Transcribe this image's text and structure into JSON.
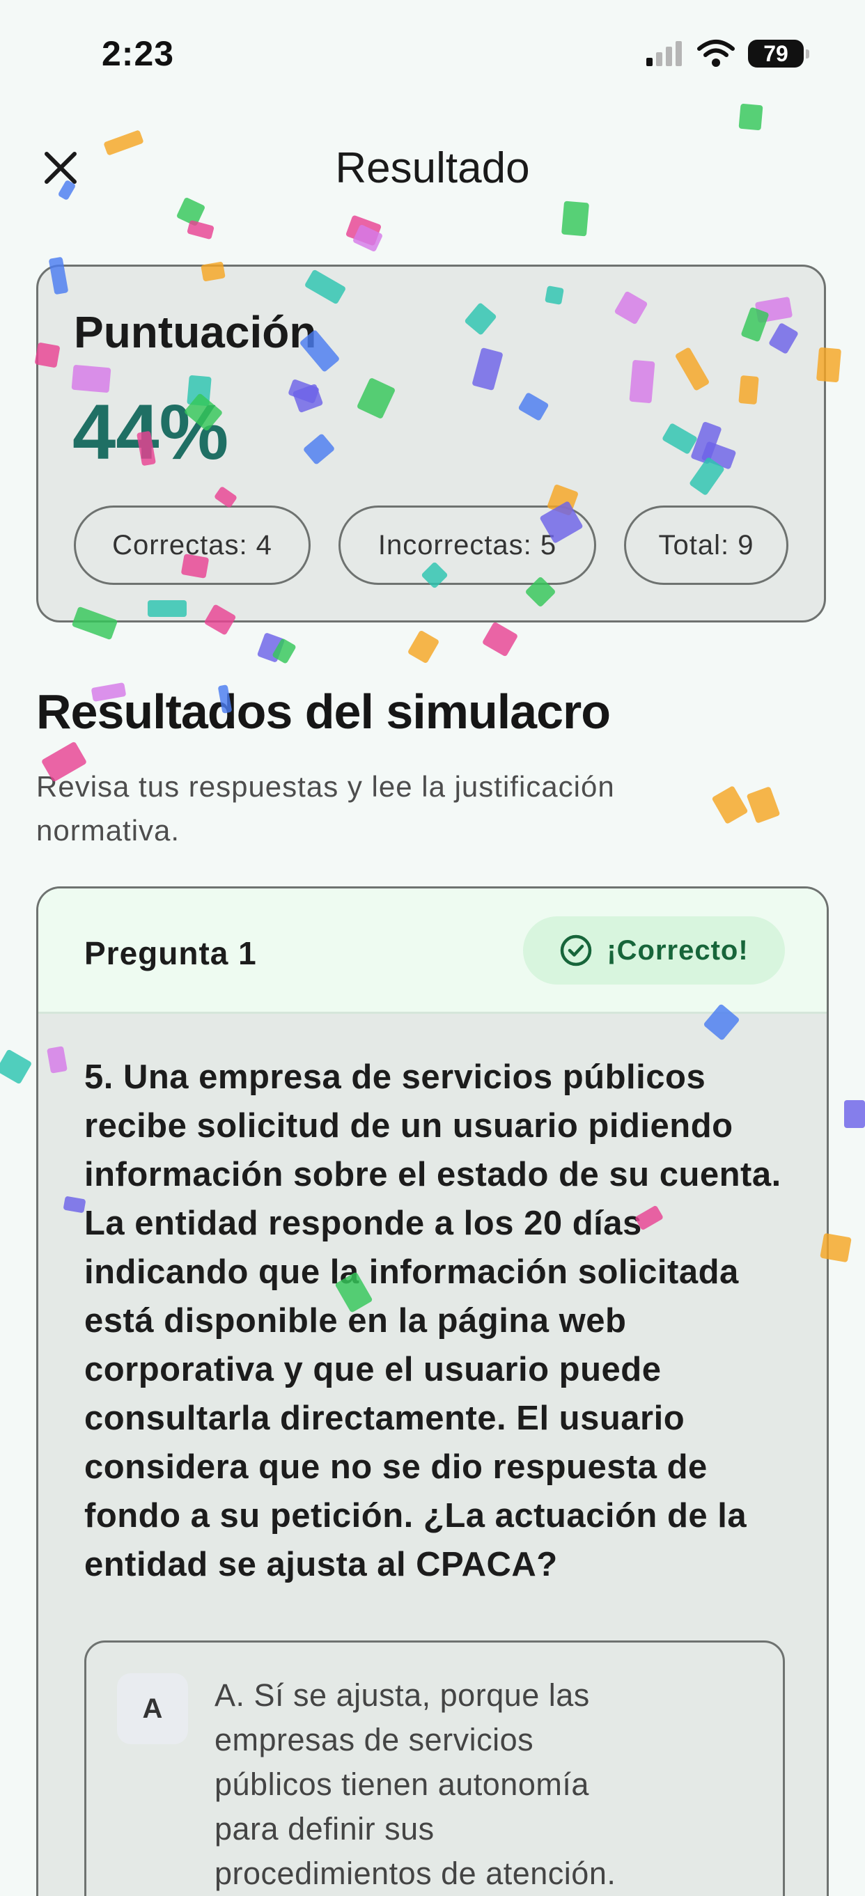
{
  "status_bar": {
    "time": "2:23",
    "battery": "79",
    "icons": [
      "signal-icon",
      "wifi-icon",
      "battery-icon"
    ]
  },
  "header": {
    "title": "Resultado",
    "close_icon": "close-icon"
  },
  "score": {
    "label": "Puntuación",
    "value": "44%",
    "correct": "Correctas: 4",
    "incorrect": "Incorrectas: 5",
    "total": "Total: 9"
  },
  "section": {
    "title": "Resultados del simulacro",
    "subtitle": "Revisa tus respuestas y lee la justificación normativa."
  },
  "question": {
    "number_label": "Pregunta 1",
    "status": "¡Correcto!",
    "text": "5. Una empresa de servicios públicos recibe solicitud de un usuario pidiendo información sobre el estado de su cuenta. La entidad responde a los 20 días indicando que la información solicitada está disponible en la página web corporativa y que el usuario puede consultarla directamente. El usuario considera que no se dio respuesta de fondo a su petición. ¿La actuación de la entidad se ajusta al CPACA?",
    "options": [
      {
        "letter": "A",
        "text": "A. Sí se ajusta, porque las empresas de servicios públicos tienen autonomía para definir sus procedimientos de atención."
      }
    ]
  },
  "colors": {
    "accent": "#1f6f64",
    "correct_green": "#17653a",
    "correct_bg": "#d8f5de",
    "confetti": [
      "#f5a623",
      "#34c759",
      "#e84393",
      "#4a7cf0",
      "#d67ae8",
      "#6c63e8",
      "#2cc4b0"
    ]
  }
}
